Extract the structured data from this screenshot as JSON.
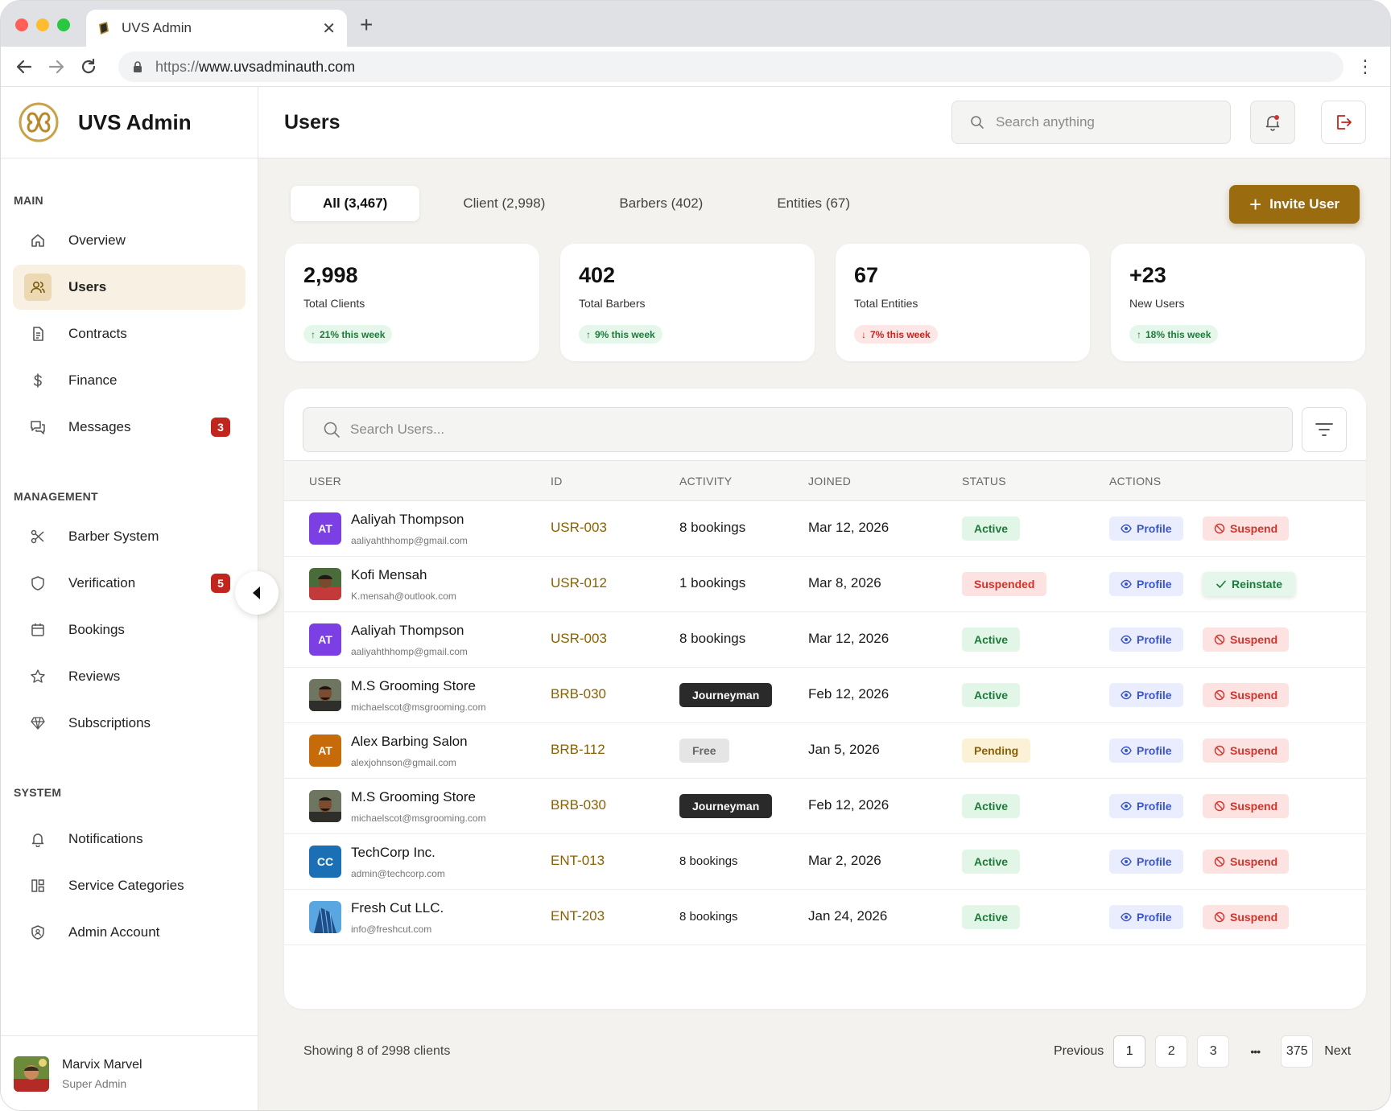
{
  "browser": {
    "tab_title": "UVS Admin",
    "url_scheme": "https://",
    "url_host": "www.uvsadminauth.com"
  },
  "app": {
    "name": "UVS Admin",
    "brand_color": "#9a6c0f"
  },
  "sidebar": {
    "sections": {
      "main": "MAIN",
      "management": "MANAGEMENT",
      "system": "SYSTEM"
    },
    "main_items": [
      {
        "label": "Overview",
        "icon": "home-icon"
      },
      {
        "label": "Users",
        "icon": "users-icon",
        "active": true
      },
      {
        "label": "Contracts",
        "icon": "document-icon"
      },
      {
        "label": "Finance",
        "icon": "dollar-icon"
      },
      {
        "label": "Messages",
        "icon": "chat-icon",
        "badge": "3"
      }
    ],
    "management_items": [
      {
        "label": "Barber System",
        "icon": "scissors-icon"
      },
      {
        "label": "Verification",
        "icon": "shield-icon",
        "badge": "5"
      },
      {
        "label": "Bookings",
        "icon": "calendar-icon"
      },
      {
        "label": "Reviews",
        "icon": "star-icon"
      },
      {
        "label": "Subscriptions",
        "icon": "diamond-icon"
      }
    ],
    "system_items": [
      {
        "label": "Notifications",
        "icon": "bell-icon"
      },
      {
        "label": "Service Categories",
        "icon": "grid-icon"
      },
      {
        "label": "Admin Account",
        "icon": "shield-user-icon"
      }
    ],
    "user": {
      "name": "Marvix Marvel",
      "role": "Super Admin"
    }
  },
  "header": {
    "title": "Users",
    "search_placeholder": "Search anything"
  },
  "tabs": [
    {
      "label": "All (3,467)",
      "active": true
    },
    {
      "label": "Client (2,998)"
    },
    {
      "label": "Barbers (402)"
    },
    {
      "label": "Entities (67)"
    }
  ],
  "invite_label": "Invite User",
  "stats": [
    {
      "value": "2,998",
      "label": "Total Clients",
      "change": "21% this week",
      "direction": "up"
    },
    {
      "value": "402",
      "label": "Total Barbers",
      "change": "9% this week",
      "direction": "up"
    },
    {
      "value": "67",
      "label": "Total Entities",
      "change": "7% this week",
      "direction": "down"
    },
    {
      "value": "+23",
      "label": "New Users",
      "change": "18% this week",
      "direction": "up"
    }
  ],
  "table": {
    "search_placeholder": "Search Users...",
    "columns": [
      "USER",
      "ID",
      "ACTIVITY",
      "JOINED",
      "STATUS",
      "ACTIONS"
    ],
    "rows": [
      {
        "initials": "AT",
        "avatar": "#7b3fe4",
        "name": "Aaliyah Thompson",
        "email": "aaliyahthhomp@gmail.com",
        "id": "USR-003",
        "activity": "8 bookings",
        "activity_style": "text",
        "joined": "Mar 12, 2026",
        "status": "Active",
        "action": "Suspend"
      },
      {
        "initials": "",
        "avatar": "photo-red",
        "name": "Kofi Mensah",
        "email": "K.mensah@outlook.com",
        "id": "USR-012",
        "activity": "1 bookings",
        "activity_style": "text",
        "joined": "Mar 8, 2026",
        "status": "Suspended",
        "action": "Reinstate"
      },
      {
        "initials": "AT",
        "avatar": "#7b3fe4",
        "name": "Aaliyah Thompson",
        "email": "aaliyahthhomp@gmail.com",
        "id": "USR-003",
        "activity": "8 bookings",
        "activity_style": "text",
        "joined": "Mar 12, 2026",
        "status": "Active",
        "action": "Suspend"
      },
      {
        "initials": "",
        "avatar": "photo-man",
        "name": "M.S Grooming Store",
        "email": "michaelscot@msgrooming.com",
        "id": "BRB-030",
        "activity": "Journeyman",
        "activity_style": "dark",
        "joined": "Feb 12, 2026",
        "status": "Active",
        "action": "Suspend"
      },
      {
        "initials": "AT",
        "avatar": "#c76a0a",
        "name": "Alex Barbing Salon",
        "email": "alexjohnson@gmail.com",
        "id": "BRB-112",
        "activity": "Free",
        "activity_style": "free",
        "joined": "Jan 5, 2026",
        "status": "Pending",
        "action": "Suspend"
      },
      {
        "initials": "",
        "avatar": "photo-man",
        "name": "M.S Grooming Store",
        "email": "michaelscot@msgrooming.com",
        "id": "BRB-030",
        "activity": "Journeyman",
        "activity_style": "dark",
        "joined": "Feb 12, 2026",
        "status": "Active",
        "action": "Suspend"
      },
      {
        "initials": "CC",
        "avatar": "#1b6fb5",
        "name": "TechCorp Inc.",
        "email": "admin@techcorp.com",
        "id": "ENT-013",
        "activity": "8 bookings",
        "activity_style": "small",
        "joined": "Mar 2, 2026",
        "status": "Active",
        "action": "Suspend"
      },
      {
        "initials": "",
        "avatar": "photo-building",
        "name": "Fresh Cut LLC.",
        "email": "info@freshcut.com",
        "id": "ENT-203",
        "activity": "8 bookings",
        "activity_style": "small",
        "joined": "Jan 24, 2026",
        "status": "Active",
        "action": "Suspend"
      }
    ],
    "profile_label": "Profile"
  },
  "footer": {
    "showing": "Showing 8 of 2998 clients",
    "previous": "Previous",
    "next": "Next",
    "pages": [
      "1",
      "2",
      "3",
      "375"
    ],
    "ellipsis": "•••"
  }
}
